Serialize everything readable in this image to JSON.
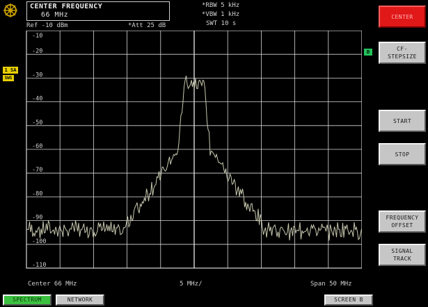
{
  "header": {
    "cf_title": "CENTER FREQUENCY",
    "cf_value": "66 MHz",
    "ref_level": "Ref -10 dBm",
    "attenuation": "*Att  25 dB",
    "rbw": "*RBW 5 kHz",
    "vbw": "*VBW 1 kHz",
    "swt": "SWT 10 s"
  },
  "markers": {
    "trace": "1 SA",
    "sweep": "SWS",
    "display": "D"
  },
  "graph": {
    "y_ticks": [
      "-10",
      "-20",
      "-30",
      "-40",
      "-50",
      "-60",
      "-70",
      "-80",
      "-90",
      "-100",
      "-110"
    ]
  },
  "footer": {
    "center": "Center  66 MHz",
    "per_div": "5 MHz/",
    "span": "Span  50 MHz"
  },
  "softkeys": {
    "center": "CENTER",
    "cf_stepsize": "CF-\nSTEPSIZE",
    "start": "START",
    "stop": "STOP",
    "frequency_offset": "FREQUENCY\nOFFSET",
    "signal_track": "SIGNAL\nTRACK"
  },
  "tabs": {
    "spectrum": "SPECTRUM",
    "network": "NETWORK",
    "screen": "SCREEN B"
  },
  "colors": {
    "grid": "#d8d8d8",
    "trace": "#c8c8b0",
    "softkey_active": "#e01818",
    "tab_active": "#3cc040",
    "marker_yellow": "#e8d000"
  },
  "icons": {
    "logo": "rohde-schwarz-logo-icon"
  }
}
